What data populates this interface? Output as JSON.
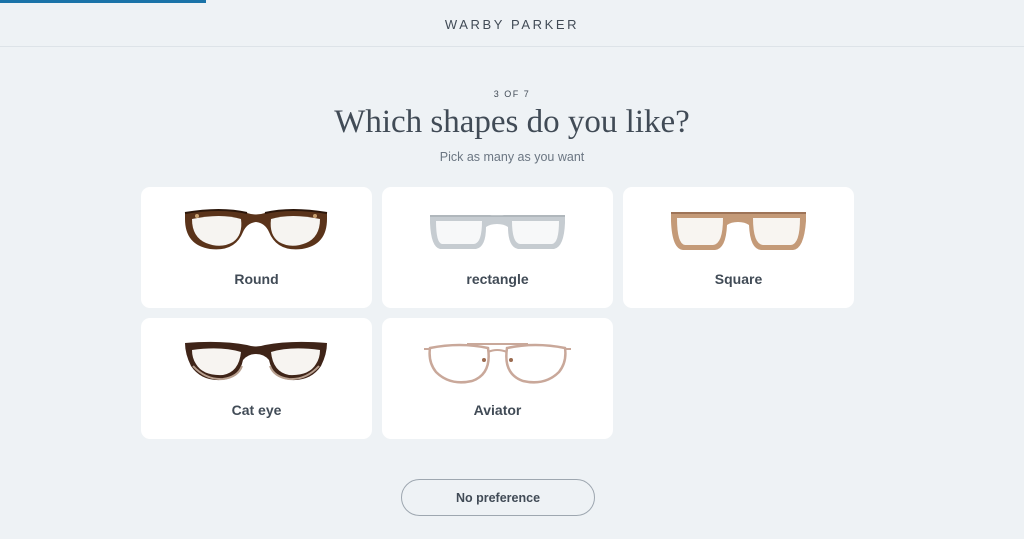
{
  "header": {
    "logo": "WARBY PARKER"
  },
  "progress": {
    "current": 3,
    "total": 7,
    "label": "3 OF 7",
    "bar_color": "#1a73a8"
  },
  "question": {
    "title": "Which shapes do you like?",
    "subtitle": "Pick as many as you want"
  },
  "options": [
    {
      "label": "Round",
      "icon": "round-glasses-icon",
      "frame_color": "#4a2a14"
    },
    {
      "label": "rectangle",
      "icon": "rectangle-glasses-icon",
      "frame_color": "#b9bfc5"
    },
    {
      "label": "Square",
      "icon": "square-glasses-icon",
      "frame_color": "#b88a68"
    },
    {
      "label": "Cat eye",
      "icon": "cat-eye-glasses-icon",
      "frame_color": "#3f2418"
    },
    {
      "label": "Aviator",
      "icon": "aviator-glasses-icon",
      "frame_color": "#c9a89a"
    }
  ],
  "footer": {
    "no_preference_label": "No preference"
  },
  "colors": {
    "background": "#eef2f5",
    "text": "#414b56",
    "card": "#ffffff"
  }
}
